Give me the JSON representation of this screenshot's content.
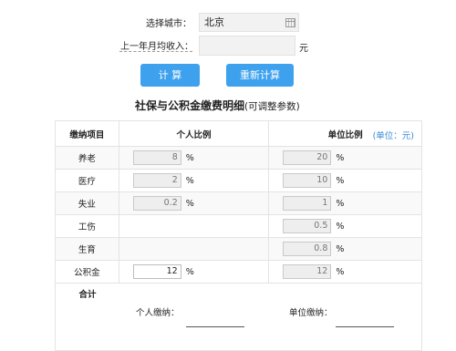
{
  "form": {
    "city_label": "选择城市：",
    "city_value": "北京",
    "income_label": "上一年月均收入：",
    "income_value": "",
    "income_unit": "元",
    "calc_button": "计 算",
    "reset_button": "重新计算"
  },
  "heading": {
    "title": "社保与公积金缴费明细",
    "subtitle": "(可调整参数)"
  },
  "table": {
    "headers": {
      "item": "缴纳项目",
      "personal": "个人比例",
      "company": "单位比例",
      "unit_note": "(单位：元)"
    },
    "pct_sign": "%",
    "rows": [
      {
        "item": "养老",
        "personal": "8",
        "company": "20"
      },
      {
        "item": "医疗",
        "personal": "2",
        "company": "10"
      },
      {
        "item": "失业",
        "personal": "0.2",
        "company": "1"
      },
      {
        "item": "工伤",
        "personal": "",
        "company": "0.5"
      },
      {
        "item": "生育",
        "personal": "",
        "company": "0.8"
      },
      {
        "item": "公积金",
        "personal": "12",
        "company": "12"
      }
    ],
    "total": {
      "label": "合计",
      "personal_label": "个人缴纳：",
      "company_label": "单位缴纳："
    }
  }
}
